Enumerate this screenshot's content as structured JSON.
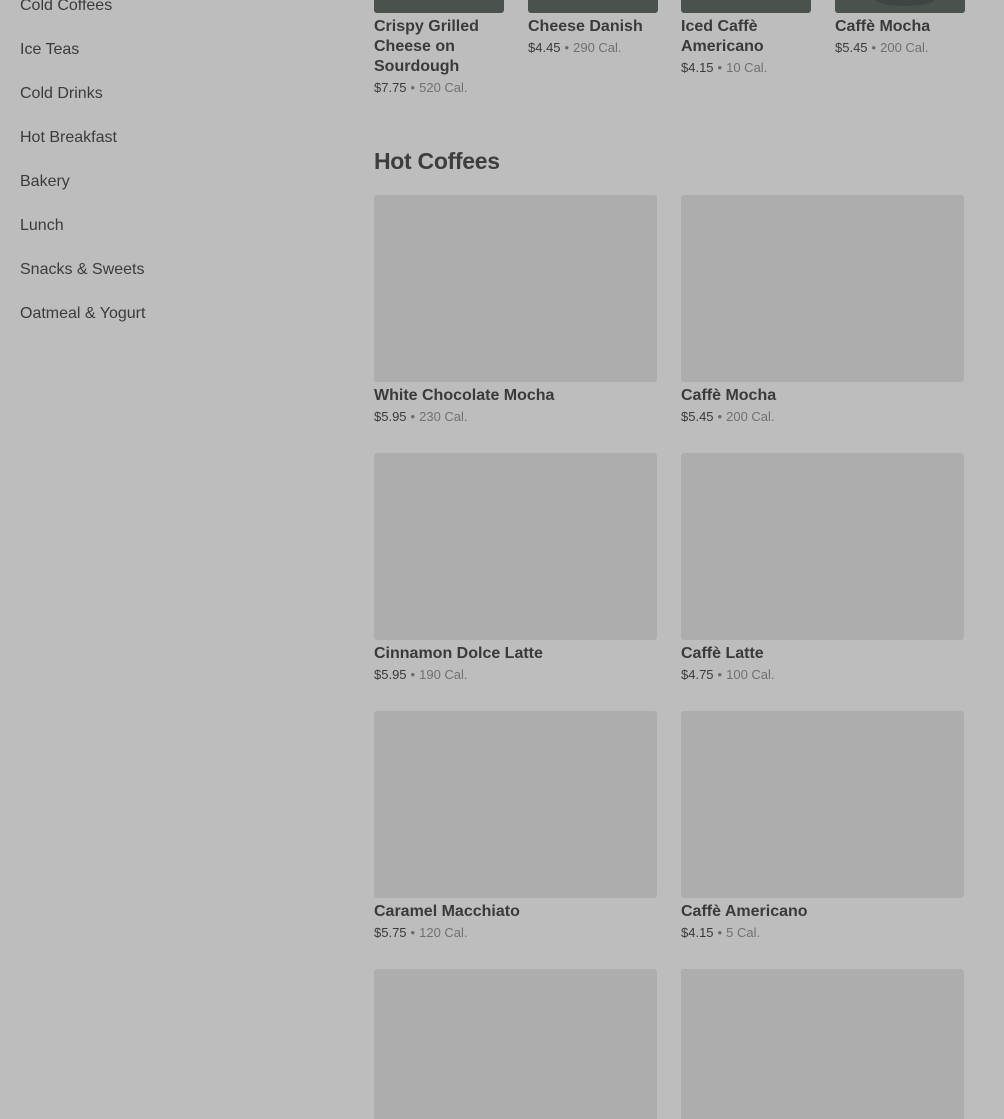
{
  "sidebar": {
    "items": [
      {
        "label": "Cold Coffees"
      },
      {
        "label": "Ice Teas"
      },
      {
        "label": "Cold Drinks"
      },
      {
        "label": "Hot Breakfast"
      },
      {
        "label": "Bakery"
      },
      {
        "label": "Lunch"
      },
      {
        "label": "Snacks & Sweets"
      },
      {
        "label": "Oatmeal & Yogurt"
      }
    ]
  },
  "featured": [
    {
      "name": "Crispy Grilled Cheese on Sourdough",
      "price": "$7.75",
      "calories": "520 Cal."
    },
    {
      "name": "Cheese Danish",
      "price": "$4.45",
      "calories": "290 Cal."
    },
    {
      "name": "Iced Caffè Americano",
      "price": "$4.15",
      "calories": "10 Cal."
    },
    {
      "name": "Caffè Mocha",
      "price": "$5.45",
      "calories": "200 Cal."
    }
  ],
  "hot_coffees": {
    "title": "Hot Coffees",
    "items": [
      {
        "name": "White Chocolate Mocha",
        "price": "$5.95",
        "calories": "230 Cal."
      },
      {
        "name": "Caffè Mocha",
        "price": "$5.45",
        "calories": "200 Cal."
      },
      {
        "name": "Cinnamon Dolce Latte",
        "price": "$5.95",
        "calories": "190 Cal."
      },
      {
        "name": "Caffè Latte",
        "price": "$4.75",
        "calories": "100 Cal."
      },
      {
        "name": "Caramel Macchiato",
        "price": "$5.75",
        "calories": "120 Cal."
      },
      {
        "name": "Caffè Americano",
        "price": "$4.15",
        "calories": "5 Cal."
      }
    ]
  },
  "separator": "•",
  "colors": {
    "background": "#bdbdbd",
    "image_placeholder": "#adadad",
    "featured_thumb": "#4a524d"
  }
}
